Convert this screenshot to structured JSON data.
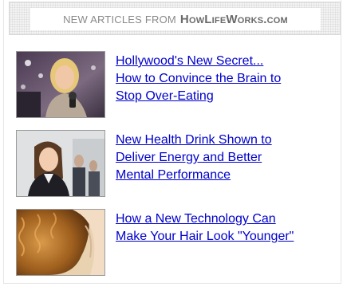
{
  "header": {
    "prefix": "NEW ARTICLES FROM",
    "brand": "HowLifeWorks.com"
  },
  "articles": [
    {
      "line1": "Hollywood's New Secret...",
      "line2": "How to Convince the Brain to",
      "line3": "Stop Over-Eating",
      "thumbnail": "celebrity-red-carpet-photo"
    },
    {
      "line1": "New Health Drink Shown to",
      "line2": "Deliver Energy and Better",
      "line3": "Mental Performance",
      "thumbnail": "business-woman-photo"
    },
    {
      "line1": "How a New Technology Can",
      "line2": "Make Your Hair Look \"Younger\"",
      "thumbnail": "curly-hair-woman-photo"
    }
  ]
}
